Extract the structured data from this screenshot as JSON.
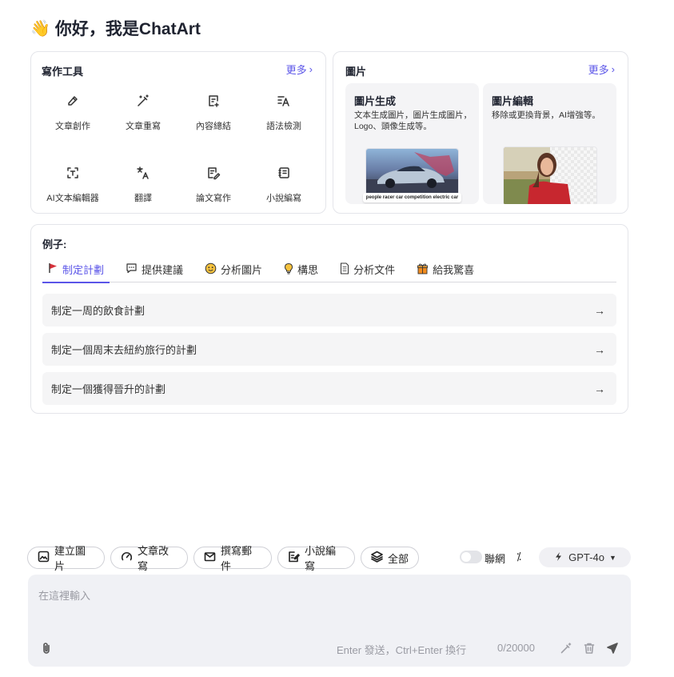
{
  "greeting": {
    "emoji": "👋",
    "text": "你好，我是ChatArt"
  },
  "tools": {
    "title": "寫作工具",
    "more": "更多",
    "items": [
      {
        "label": "文章創作",
        "icon": "pen-nib-icon"
      },
      {
        "label": "文章重寫",
        "icon": "magic-wand-icon"
      },
      {
        "label": "內容總結",
        "icon": "summary-doc-icon"
      },
      {
        "label": "語法檢測",
        "icon": "grammar-check-icon"
      },
      {
        "label": "AI文本編輯器",
        "icon": "text-editor-icon"
      },
      {
        "label": "翻譯",
        "icon": "translate-icon"
      },
      {
        "label": "論文寫作",
        "icon": "paper-write-icon"
      },
      {
        "label": "小說編寫",
        "icon": "novel-book-icon"
      }
    ]
  },
  "images": {
    "title": "圖片",
    "more": "更多",
    "generate": {
      "title": "圖片生成",
      "desc": "文本生成圖片，圖片生成圖片，Logo、頭像生成等。",
      "prompt_text": "people racer car competition electric car"
    },
    "edit": {
      "title": "圖片編輯",
      "desc": "移除或更換背景，AI增強等。"
    }
  },
  "examples": {
    "title": "例子:",
    "tabs": [
      {
        "label": "制定計劃",
        "icon": "flag-icon"
      },
      {
        "label": "提供建議",
        "icon": "chat-bubble-icon"
      },
      {
        "label": "分析圖片",
        "icon": "smiley-icon"
      },
      {
        "label": "構思",
        "icon": "lightbulb-icon"
      },
      {
        "label": "分析文件",
        "icon": "document-icon"
      },
      {
        "label": "給我驚喜",
        "icon": "gift-icon"
      }
    ],
    "items": [
      "制定一周的飲食計劃",
      "制定一個周末去紐約旅行的計劃",
      "制定一個獲得晉升的計劃"
    ]
  },
  "quick_actions": [
    {
      "label": "建立圖片",
      "icon": "image-icon"
    },
    {
      "label": "文章改寫",
      "icon": "gauge-icon"
    },
    {
      "label": "撰寫郵件",
      "icon": "mail-icon"
    },
    {
      "label": "小說編寫",
      "icon": "edit-doc-icon"
    },
    {
      "label": "全部",
      "icon": "layers-icon"
    }
  ],
  "web_toggle": {
    "label": "聯網",
    "on": false
  },
  "model": {
    "label": "GPT-4o"
  },
  "input": {
    "placeholder": "在這裡輸入",
    "hint": "Enter 發送，Ctrl+Enter 換行",
    "counter": "0/20000"
  },
  "colors": {
    "accent": "#5b55e8",
    "panel": "#f0f1f5"
  }
}
